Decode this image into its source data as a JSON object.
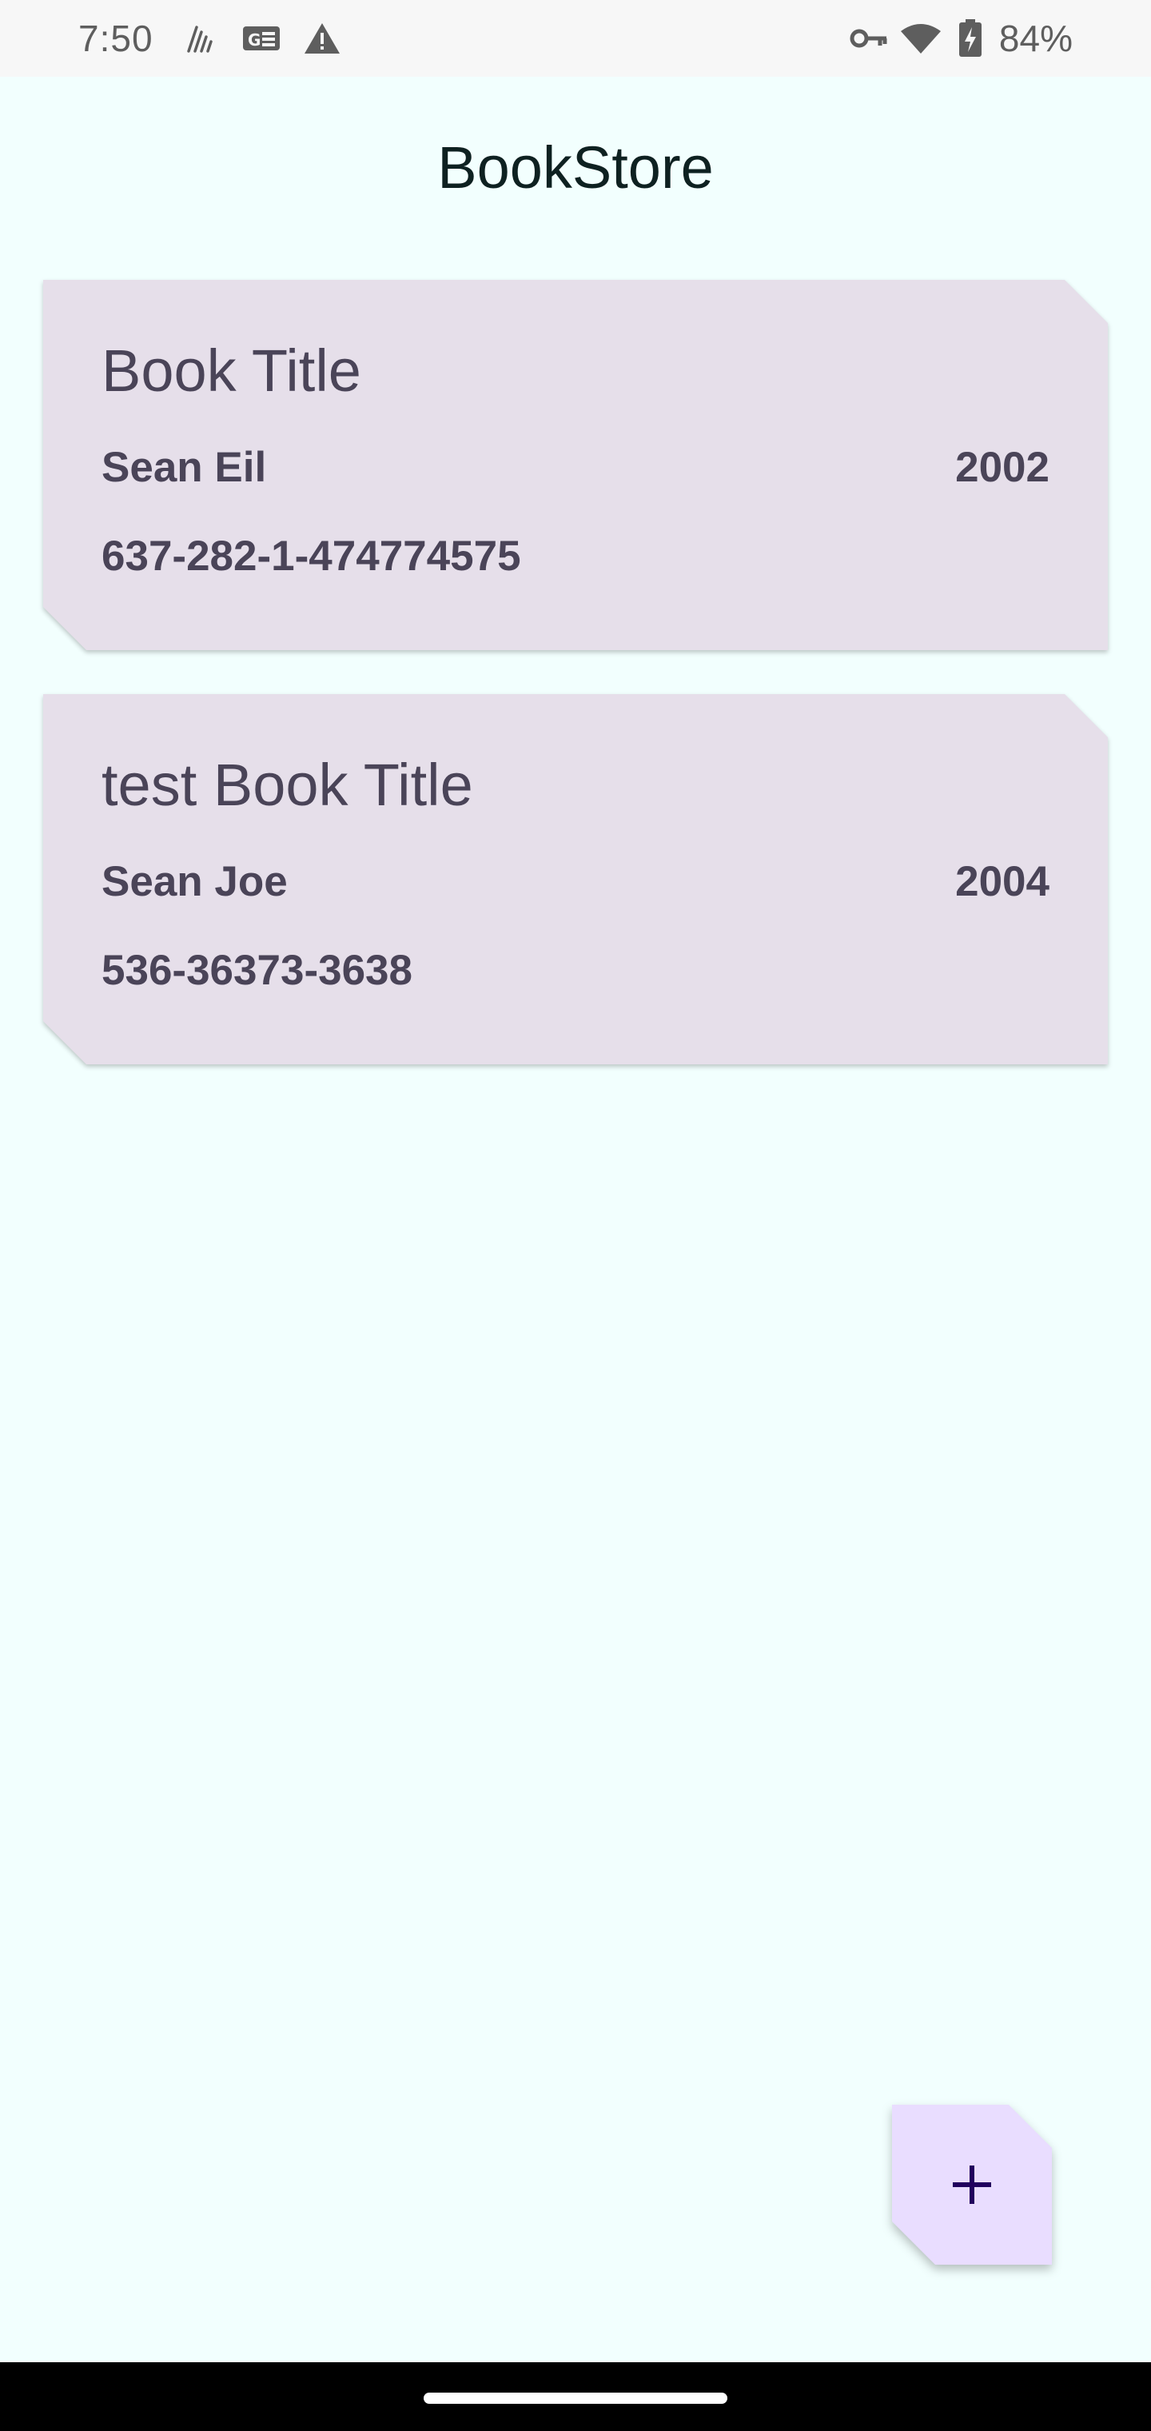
{
  "status_bar": {
    "time": "7:50",
    "battery_percent": "84%",
    "icons_left": [
      "signal-strength-icon",
      "news-card-icon",
      "warning-icon"
    ],
    "icons_right": [
      "vpn-key-icon",
      "wifi-icon",
      "battery-charging-icon"
    ]
  },
  "app": {
    "title": "BookStore"
  },
  "books": [
    {
      "title": "Book Title",
      "author": "Sean Eil",
      "year": "2002",
      "isbn": "637-282-1-474774575"
    },
    {
      "title": "test Book Title",
      "author": "Sean Joe",
      "year": "2004",
      "isbn": "536-36373-3638"
    }
  ],
  "fab": {
    "icon": "plus-icon"
  },
  "colors": {
    "background": "#F2FFFE",
    "card": "#E6DFEA",
    "card_text": "#4A4458",
    "fab": "#E9DDFF",
    "fab_icon": "#21005D",
    "title_text": "#0E2121"
  }
}
